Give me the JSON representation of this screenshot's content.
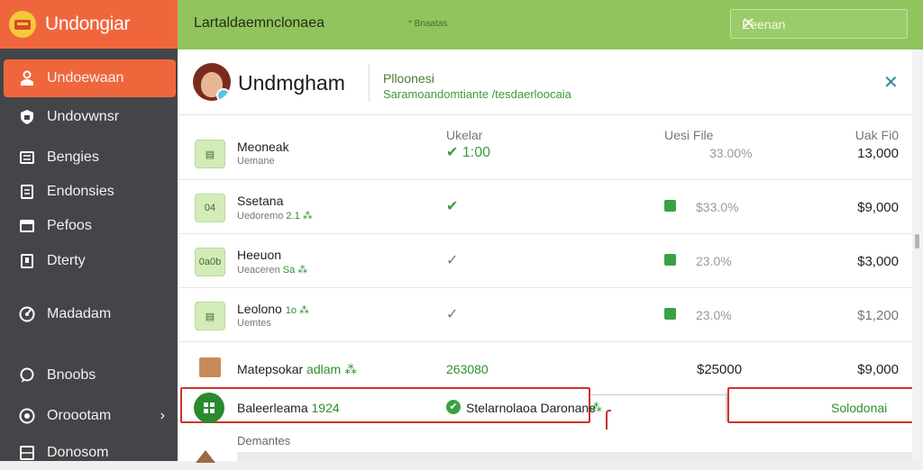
{
  "app": {
    "title": "Undongiar"
  },
  "sidebar": {
    "items": [
      {
        "label": "Undoewaan",
        "icon": "user-icon",
        "active": true
      },
      {
        "label": "Undovwnsr",
        "icon": "shield-icon"
      },
      {
        "label": "Bengies",
        "icon": "list-icon"
      },
      {
        "label": "Endonsies",
        "icon": "document-icon"
      },
      {
        "label": "Pefoos",
        "icon": "window-icon"
      },
      {
        "label": "Dterty",
        "icon": "page-icon"
      },
      {
        "label": "Madadam",
        "icon": "dashboard-icon"
      },
      {
        "label": "Bnoobs",
        "icon": "chat-icon"
      },
      {
        "label": "Oroootam",
        "icon": "record-icon"
      },
      {
        "label": "Donosom",
        "icon": "server-icon"
      }
    ]
  },
  "topbar": {
    "title": "Lartaldaemnclonaea",
    "subtitle": "* Bnaatas",
    "search_value": "Eeenan"
  },
  "profile": {
    "name": "Undmgham",
    "label": "Plloonesi",
    "sub": "Saramoandomtiante  /tesdaerloocaia"
  },
  "columns": {
    "c1": "Ukelar",
    "c2": "Uesi File",
    "c3": "Uak Fi0"
  },
  "rows": [
    {
      "icon_text": "▤",
      "name": "Meoneak",
      "sub": "Uemane",
      "sub_green": "",
      "check": "✔ 1:00",
      "check_style": "green",
      "pct": "33.00%",
      "amount": "13,000",
      "square": false
    },
    {
      "icon_text": "04",
      "name": "Ssetana",
      "sub": "Uedoremo ",
      "sub_green": "2.1 ⁂",
      "check": "✔",
      "check_style": "green",
      "pct": "$33.0%",
      "amount": "$9,000",
      "square": true
    },
    {
      "icon_text": "0a0b",
      "name": "Heeuon",
      "sub": "Ueaceren ",
      "sub_green": "Sa ⁂",
      "check": "✓",
      "check_style": "muted",
      "pct": "23.0%",
      "amount": "$3,000",
      "square": true
    },
    {
      "icon_text": "▤",
      "name": "Leolono ",
      "name_green": "1o ⁂",
      "sub": "Uemtes",
      "sub_green": "",
      "check": "✓",
      "check_style": "muted",
      "pct": "23.0%",
      "amount": "$1,200",
      "square": true
    }
  ],
  "summary": {
    "name": "Matepsokar ",
    "name_green": "adlam ⁂",
    "value": "263080",
    "amount1": "$25000",
    "amount2": "$9,000"
  },
  "selected": {
    "name": "Baleerleama ",
    "name_green": "1924",
    "label": "Stelarnolaoa Daronane",
    "tag": "⁂",
    "action": "Solodonai"
  },
  "footer": {
    "label": "Demantes"
  }
}
